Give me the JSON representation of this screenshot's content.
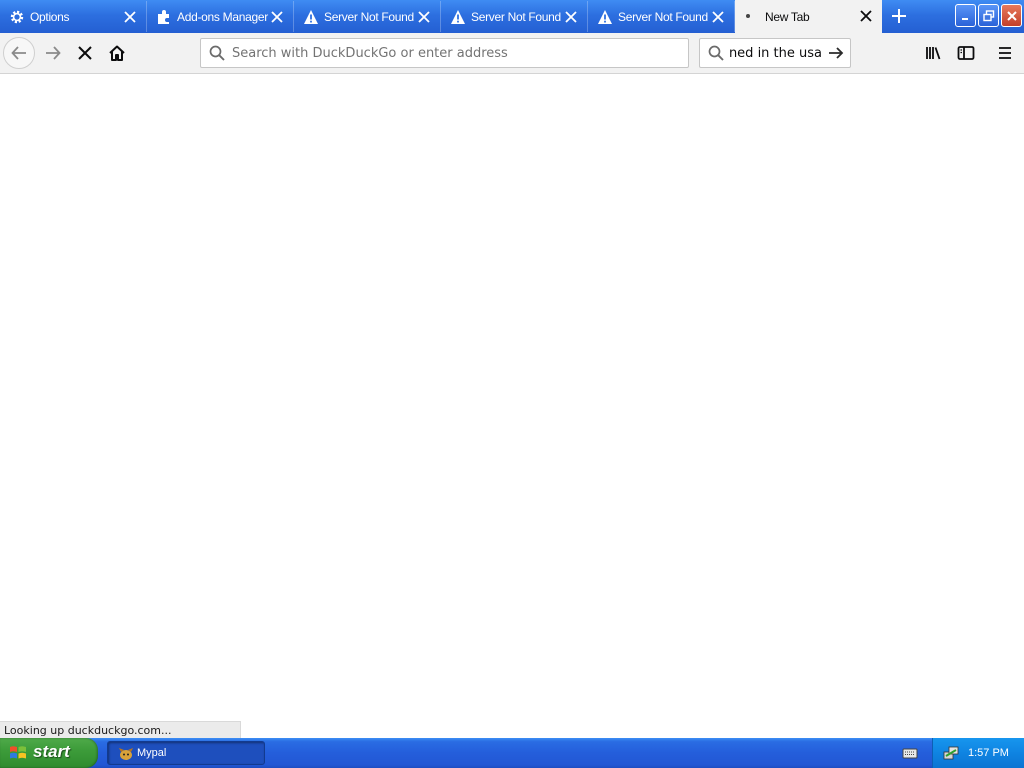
{
  "tabs": [
    {
      "label": "Options",
      "icon": "gear-icon"
    },
    {
      "label": "Add-ons Manager",
      "icon": "puzzle-icon"
    },
    {
      "label": "Server Not Found",
      "icon": "warning-icon"
    },
    {
      "label": "Server Not Found",
      "icon": "warning-icon"
    },
    {
      "label": "Server Not Found",
      "icon": "warning-icon"
    },
    {
      "label": "New Tab",
      "icon": "loading-dot-icon",
      "active": true
    }
  ],
  "address_bar": {
    "placeholder": "Search with DuckDuckGo or enter address",
    "value": ""
  },
  "search_bar": {
    "value": "nned in the usa"
  },
  "status": {
    "text": "Looking up duckduckgo.com..."
  },
  "taskbar": {
    "start_label": "start",
    "window_label": "Mypal",
    "clock": "1:57 PM"
  },
  "colors": {
    "tabstrip": "#245fd2",
    "active_tab": "#f2f2f2",
    "toolbar": "#f2f2f2",
    "taskbar": "#245edb",
    "start_button": "#3d9c3a",
    "tray": "#0f84e2"
  }
}
